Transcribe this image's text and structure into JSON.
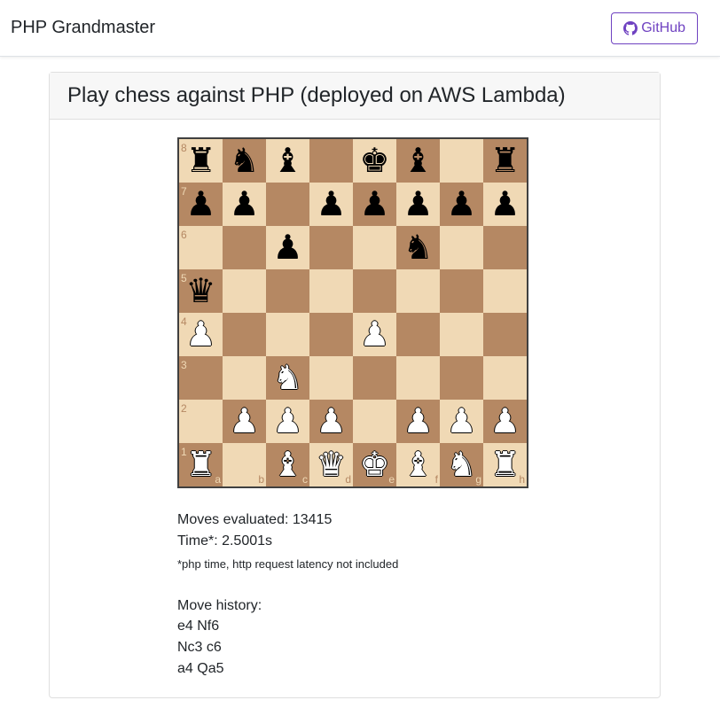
{
  "navbar": {
    "brand": "PHP Grandmaster",
    "github_label": "GitHub",
    "github_icon": "github-icon"
  },
  "card": {
    "title": "Play chess against PHP (deployed on AWS Lambda)"
  },
  "board": {
    "files": [
      "a",
      "b",
      "c",
      "d",
      "e",
      "f",
      "g",
      "h"
    ],
    "ranks": [
      "8",
      "7",
      "6",
      "5",
      "4",
      "3",
      "2",
      "1"
    ],
    "position": [
      [
        "bR",
        "bN",
        "bB",
        "",
        "bK",
        "bB",
        "",
        "bR"
      ],
      [
        "bP",
        "bP",
        "",
        "bP",
        "bP",
        "bP",
        "bP",
        "bP"
      ],
      [
        "",
        "",
        "bP",
        "",
        "",
        "bN",
        "",
        ""
      ],
      [
        "bQ",
        "",
        "",
        "",
        "",
        "",
        "",
        ""
      ],
      [
        "wP",
        "",
        "",
        "",
        "wP",
        "",
        "",
        ""
      ],
      [
        "",
        "",
        "wN",
        "",
        "",
        "",
        "",
        ""
      ],
      [
        "",
        "wP",
        "wP",
        "wP",
        "",
        "wP",
        "wP",
        "wP"
      ],
      [
        "wR",
        "",
        "wB",
        "wQ",
        "wK",
        "wB",
        "wN",
        "wR"
      ]
    ],
    "colors": {
      "light": "#f0d9b5",
      "dark": "#b58863"
    }
  },
  "stats": {
    "moves_evaluated": "Moves evaluated: 13415",
    "time": "Time*: 2.5001s",
    "note": "*php time, http request latency not included"
  },
  "history": {
    "label": "Move history:",
    "moves": [
      "e4 Nf6",
      "Nc3 c6",
      "a4 Qa5"
    ]
  },
  "theme": {
    "accent": "#6f42c1"
  }
}
